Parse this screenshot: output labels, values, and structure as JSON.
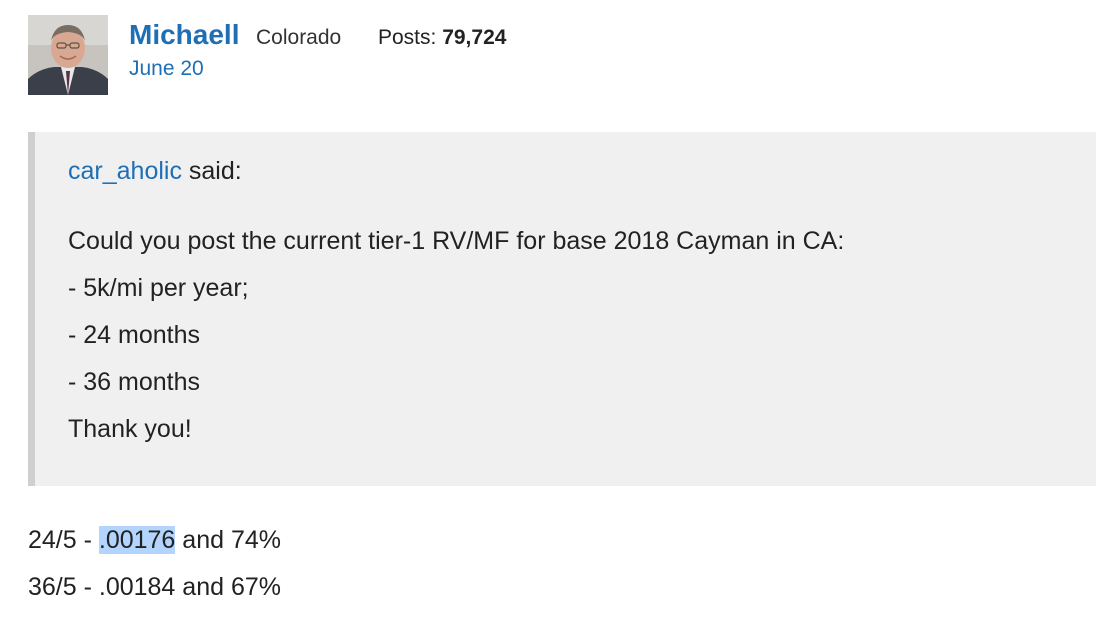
{
  "author": {
    "name": "Michaell",
    "location": "Colorado",
    "posts_label": "Posts:",
    "posts_count": "79,724",
    "date": "June 20",
    "avatar_icon": "user-photo-icon"
  },
  "quote": {
    "author": "car_aholic",
    "said_label": " said:",
    "lines": [
      "Could you post the current tier-1 RV/MF for base 2018 Cayman in CA:",
      "- 5k/mi per year;",
      "- 24 months",
      "- 36 months",
      "Thank you!"
    ]
  },
  "reply": {
    "line1_prefix": "24/5 - ",
    "line1_highlight": ".00176",
    "line1_suffix": " and 74%",
    "line2": "36/5 - .00184 and 67%"
  },
  "colors": {
    "link": "#1f6fb5",
    "quote_bg": "#f0f0f0",
    "quote_border": "#cfcfcf",
    "selection": "#b3d4fd"
  }
}
